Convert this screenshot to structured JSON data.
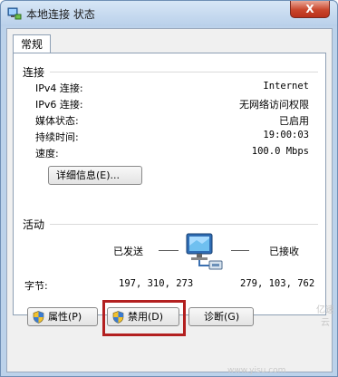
{
  "window": {
    "title": "本地连接 状态",
    "close_glyph": "X",
    "accent": "#b9d0ea",
    "close_color": "#c9462c"
  },
  "tab": {
    "label": "常规"
  },
  "connection": {
    "heading": "连接",
    "rows": [
      {
        "key": "IPv4 连接:",
        "value": "Internet"
      },
      {
        "key": "IPv6 连接:",
        "value": "无网络访问权限"
      },
      {
        "key": "媒体状态:",
        "value": "已启用"
      },
      {
        "key": "持续时间:",
        "value": "19:00:03"
      },
      {
        "key": "速度:",
        "value": "100.0 Mbps"
      }
    ],
    "details_button": "详细信息(E)..."
  },
  "activity": {
    "heading": "活动",
    "sent_label": "已发送",
    "received_label": "已接收",
    "bytes_label": "字节:",
    "bytes_sent": "197, 310, 273",
    "bytes_received": "279, 103, 762",
    "icon": "network-computer-icon"
  },
  "buttons": {
    "properties": "属性(P)",
    "disable": "禁用(D)",
    "diagnose": "诊断(G)",
    "shield_icon": "uac-shield-icon"
  },
  "highlight_color": "#b32020",
  "watermark": {
    "side_text": "亿速云",
    "bottom_text": "www.yisu.com"
  }
}
